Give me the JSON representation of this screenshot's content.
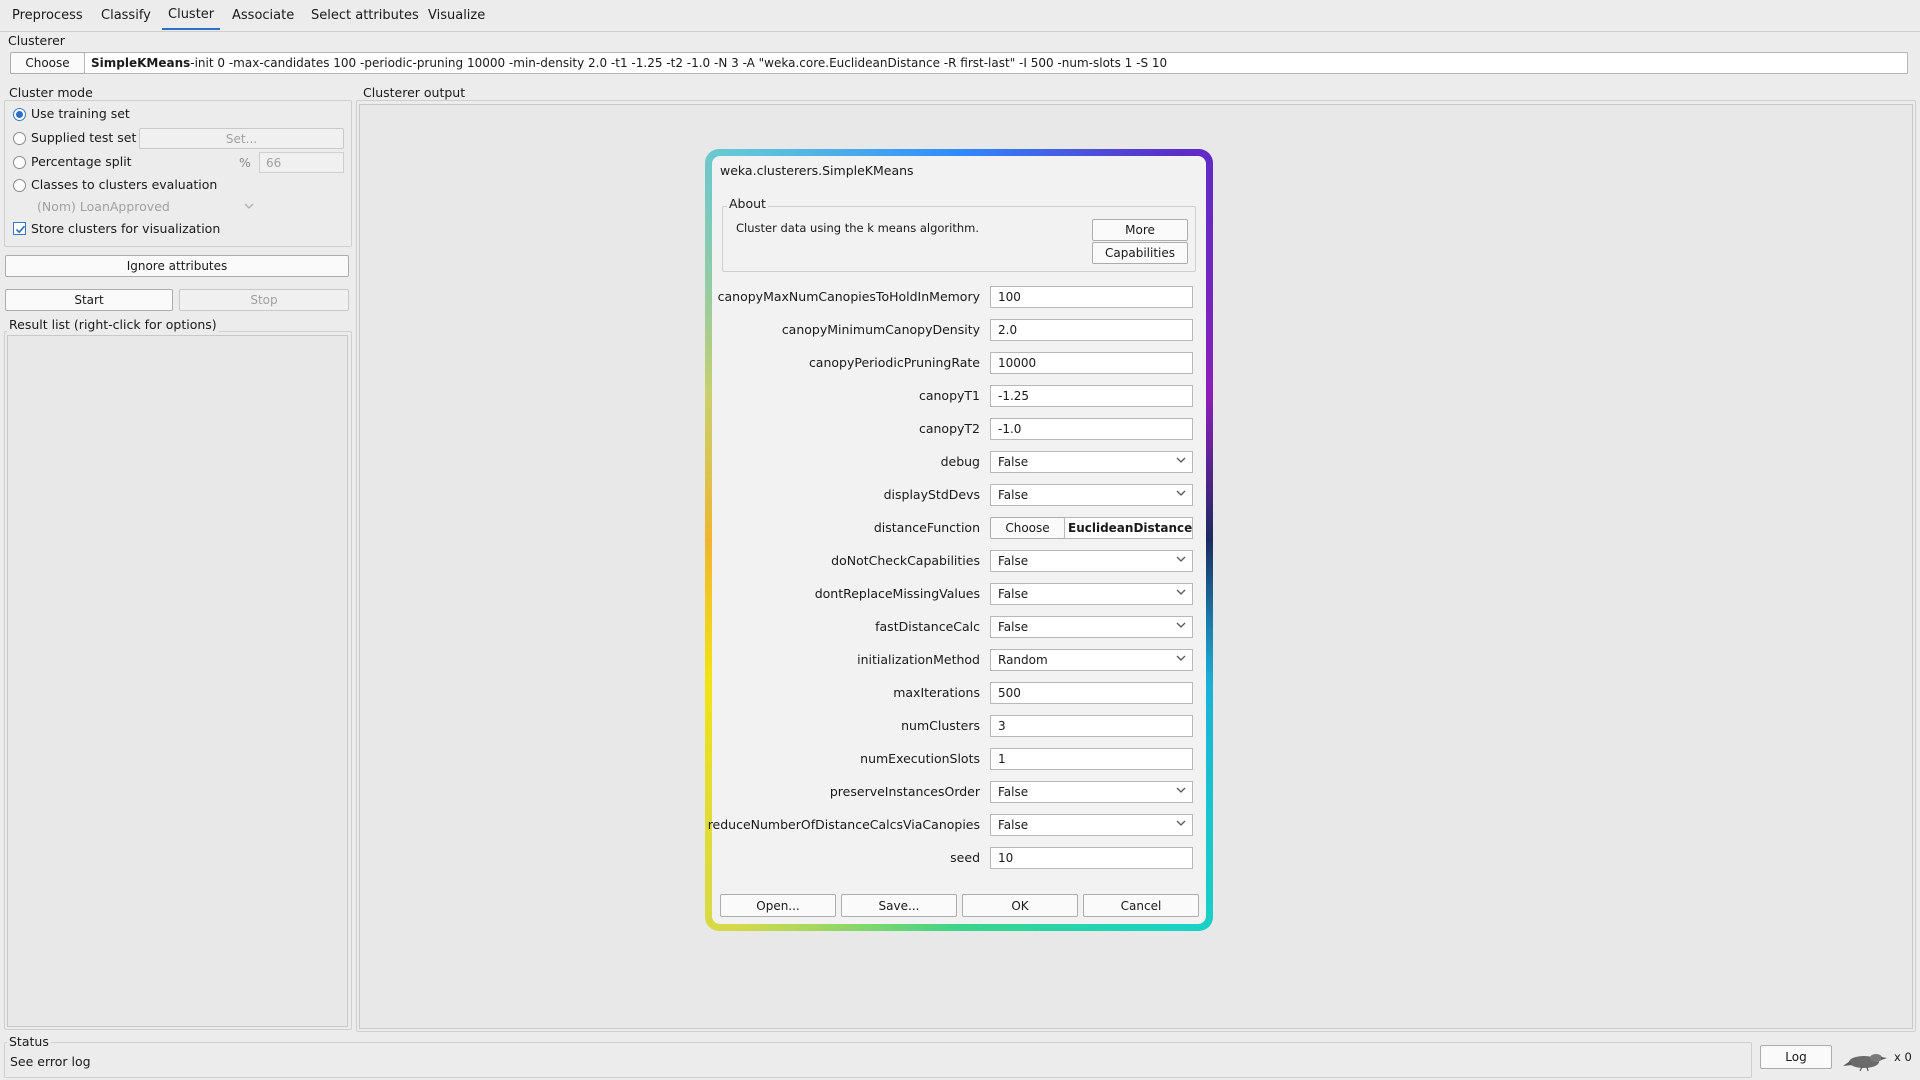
{
  "tabs": [
    "Preprocess",
    "Classify",
    "Cluster",
    "Associate",
    "Select attributes",
    "Visualize"
  ],
  "clusterer": {
    "section_title": "Clusterer",
    "choose_label": "Choose",
    "name": "SimpleKMeans",
    "options": " -init 0 -max-candidates 100 -periodic-pruning 10000 -min-density 2.0 -t1 -1.25 -t2 -1.0 -N 3 -A \"weka.core.EuclideanDistance -R first-last\" -I 500 -num-slots 1 -S 10"
  },
  "cluster_mode": {
    "title": "Cluster mode",
    "use_training": "Use training set",
    "supplied_test": "Supplied test set",
    "set_button": "Set...",
    "percentage_split": "Percentage split",
    "percent_symbol": "%",
    "percent_value": "66",
    "classes_to_clusters": "Classes to clusters evaluation",
    "class_attribute": "(Nom) LoanApproved",
    "store_clusters": "Store clusters for visualization"
  },
  "ignore_attributes": "Ignore attributes",
  "start": "Start",
  "stop": "Stop",
  "result_list_title": "Result list (right-click for options)",
  "output_title": "Clusterer output",
  "status": {
    "title": "Status",
    "text": "See error log",
    "log_button": "Log",
    "count": "x 0"
  },
  "dialog": {
    "title": "weka.clusterers.SimpleKMeans",
    "about_title": "About",
    "about_text": "Cluster data using the k means algorithm.",
    "more_button": "More",
    "capabilities_button": "Capabilities",
    "properties": [
      {
        "label": "canopyMaxNumCanopiesToHoldInMemory",
        "value": "100",
        "kind": "text"
      },
      {
        "label": "canopyMinimumCanopyDensity",
        "value": "2.0",
        "kind": "text"
      },
      {
        "label": "canopyPeriodicPruningRate",
        "value": "10000",
        "kind": "text"
      },
      {
        "label": "canopyT1",
        "value": "-1.25",
        "kind": "text"
      },
      {
        "label": "canopyT2",
        "value": "-1.0",
        "kind": "text"
      },
      {
        "label": "debug",
        "value": "False",
        "kind": "select"
      },
      {
        "label": "displayStdDevs",
        "value": "False",
        "kind": "select"
      },
      {
        "label": "distanceFunction",
        "value": "EuclideanDistance -R first-last",
        "kind": "chooser",
        "choose": "Choose"
      },
      {
        "label": "doNotCheckCapabilities",
        "value": "False",
        "kind": "select"
      },
      {
        "label": "dontReplaceMissingValues",
        "value": "False",
        "kind": "select"
      },
      {
        "label": "fastDistanceCalc",
        "value": "False",
        "kind": "select"
      },
      {
        "label": "initializationMethod",
        "value": "Random",
        "kind": "select"
      },
      {
        "label": "maxIterations",
        "value": "500",
        "kind": "text"
      },
      {
        "label": "numClusters",
        "value": "3",
        "kind": "text"
      },
      {
        "label": "numExecutionSlots",
        "value": "1",
        "kind": "text"
      },
      {
        "label": "preserveInstancesOrder",
        "value": "False",
        "kind": "select"
      },
      {
        "label": "reduceNumberOfDistanceCalcsViaCanopies",
        "value": "False",
        "kind": "select"
      },
      {
        "label": "seed",
        "value": "10",
        "kind": "text"
      }
    ],
    "open_button": "Open...",
    "save_button": "Save...",
    "ok_button": "OK",
    "cancel_button": "Cancel"
  },
  "colors": {
    "accent": "#2d6fc4"
  }
}
